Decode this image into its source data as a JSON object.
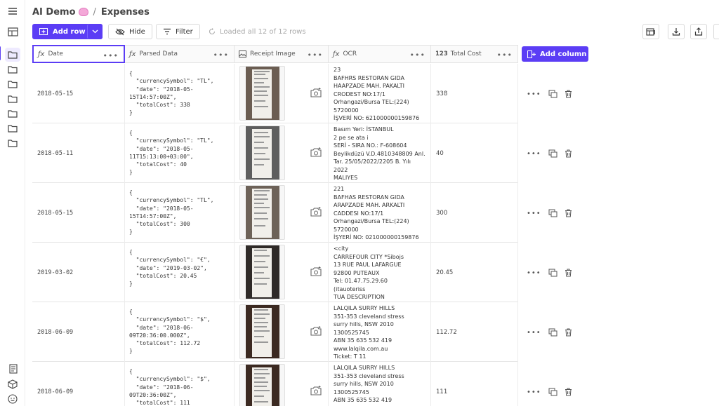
{
  "header": {
    "workspace": "AI Demo",
    "separator": "/",
    "table": "Expenses"
  },
  "toolbar": {
    "add_row": "Add row",
    "hide": "Hide",
    "filter": "Filter",
    "status": "Loaded all 12 of 12 rows"
  },
  "columns": {
    "date": "Date",
    "parsed": "Parsed Data",
    "receipt": "Receipt Image",
    "ocr": "OCR",
    "cost_prefix": "123",
    "cost": "Total Cost",
    "add_column": "Add column"
  },
  "rows": [
    {
      "date": "2018-05-15",
      "parsed": "{\n  \"currencySymbol\": \"TL\",\n  \"date\": \"2018-05-\n15T14:57:00Z\",\n  \"totalCost\": 338\n}",
      "ocr": "23\nBAFHRS RESTORAN GIDA\nHAAPZADE MAH. PAKALTI\nCRODEST NO:17/1\nOrhangazi/Bursa TEL:(224)\n5720000\nİŞVERİ NO: 621000000159876",
      "cost": "338"
    },
    {
      "date": "2018-05-11",
      "parsed": "{\n  \"currencySymbol\": \"TL\",\n  \"date\": \"2018-05-\n11T15:13:00+03:00\",\n  \"totalCost\": 40\n}",
      "ocr": "Basım Yeri: İSTANBUL\n2 pe se ata i\nSERİ - SIRA NO.: F-608604\nBeylikdüzü V.D.4810348809 Anl.\nTar. 25/05/2022/2205 B. Yılı\n2022\nMALIYES",
      "cost": "40"
    },
    {
      "date": "2018-05-15",
      "parsed": "{\n  \"currencySymbol\": \"TL\",\n  \"date\": \"2018-05-\n15T14:57:00Z\",\n  \"totalCost\": 300\n}",
      "ocr": "221\nBAFHAS RESTORAN GIDA\nARAPZADE MAH. ARKALTI\nCADDESI NO:17/1\nOrhangazi/Bursa TEL:(224)\n5720000\nİŞYERİ NO: 021000000159876",
      "cost": "300"
    },
    {
      "date": "2019-03-02",
      "parsed": "{\n  \"currencySymbol\": \"€\",\n  \"date\": \"2019-03-02\",\n  \"totalCost\": 20.45\n}",
      "ocr": "<city\nCARREFOUR CITY *Sibojs\n13 RUE PAUL LAFARGUE\n92800 PUTEAUX\nTel: 01.47.75.29.60\n(itauoteriss\nTUA DESCRIPTION",
      "cost": "20.45"
    },
    {
      "date": "2018-06-09",
      "parsed": "{\n  \"currencySymbol\": \"$\",\n  \"date\": \"2018-06-\n09T20:36:00.000Z\",\n  \"totalCost\": 112.72\n}",
      "ocr": "LALQILA SURRY HILLS\n351-353 cleveland stress\nsurry hills, NSW 2010\n1300525745\nABN 35 635 532 419\nwww.lalqila.com.au\nTicket: T 11",
      "cost": "112.72"
    },
    {
      "date": "2018-06-09",
      "parsed": "{\n  \"currencySymbol\": \"$\",\n  \"date\": \"2018-06-\n09T20:36:00Z\",\n  \"totalCost\": 111\n}",
      "ocr": "LALQILA SURRY HILLS\n351-353 cleveland stress\nsurry hills, NSW 2010\n1300525745\nABN 35 635 532 419",
      "cost": "111"
    }
  ],
  "colors": {
    "accent": "#5b3df5",
    "accent_light": "#eeeaff"
  },
  "icons": [
    "menu-icon",
    "table-icon",
    "folder-icon",
    "brain-icon",
    "plus-icon",
    "chevron-down-icon",
    "eye-off-icon",
    "filter-icon",
    "refresh-icon",
    "fx-icon",
    "image-icon",
    "more-icon",
    "camera-add-icon",
    "duplicate-icon",
    "trash-icon",
    "export-icon",
    "share-icon",
    "docs-icon",
    "box-icon",
    "smile-icon"
  ]
}
